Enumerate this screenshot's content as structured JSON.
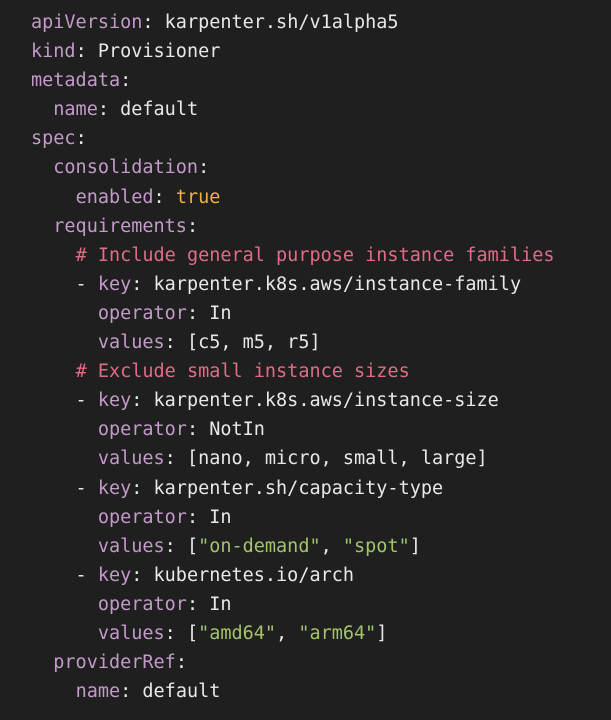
{
  "theme": {
    "background": "#1f1f1f",
    "text": "#e8e8e8",
    "key": "#c39ac9",
    "boolean": "#f2b33d",
    "string": "#a3c46b",
    "comment": "#e06c86"
  },
  "lines": [
    [
      {
        "t": "apiVersion",
        "c": "key"
      },
      {
        "t": ": ",
        "c": "punct"
      },
      {
        "t": "karpenter.sh/v1alpha5",
        "c": "plain"
      }
    ],
    [
      {
        "t": "kind",
        "c": "key"
      },
      {
        "t": ": ",
        "c": "punct"
      },
      {
        "t": "Provisioner",
        "c": "plain"
      }
    ],
    [
      {
        "t": "metadata",
        "c": "key"
      },
      {
        "t": ":",
        "c": "punct"
      }
    ],
    [
      {
        "t": "  "
      },
      {
        "t": "name",
        "c": "key"
      },
      {
        "t": ": ",
        "c": "punct"
      },
      {
        "t": "default",
        "c": "plain"
      }
    ],
    [
      {
        "t": "spec",
        "c": "key"
      },
      {
        "t": ":",
        "c": "punct"
      }
    ],
    [
      {
        "t": "  "
      },
      {
        "t": "consolidation",
        "c": "key"
      },
      {
        "t": ":",
        "c": "punct"
      }
    ],
    [
      {
        "t": "    "
      },
      {
        "t": "enabled",
        "c": "key"
      },
      {
        "t": ": ",
        "c": "punct"
      },
      {
        "t": "true",
        "c": "bool"
      }
    ],
    [
      {
        "t": "  "
      },
      {
        "t": "requirements",
        "c": "key"
      },
      {
        "t": ":",
        "c": "punct"
      }
    ],
    [
      {
        "t": "    "
      },
      {
        "t": "# Include general purpose instance families",
        "c": "comment"
      }
    ],
    [
      {
        "t": "    - ",
        "c": "punct"
      },
      {
        "t": "key",
        "c": "key"
      },
      {
        "t": ": ",
        "c": "punct"
      },
      {
        "t": "karpenter.k8s.aws/instance-family",
        "c": "plain"
      }
    ],
    [
      {
        "t": "      "
      },
      {
        "t": "operator",
        "c": "key"
      },
      {
        "t": ": ",
        "c": "punct"
      },
      {
        "t": "In",
        "c": "plain"
      }
    ],
    [
      {
        "t": "      "
      },
      {
        "t": "values",
        "c": "key"
      },
      {
        "t": ": ",
        "c": "punct"
      },
      {
        "t": "[c5, m5, r5]",
        "c": "plain"
      }
    ],
    [
      {
        "t": "    "
      },
      {
        "t": "# Exclude small instance sizes",
        "c": "comment"
      }
    ],
    [
      {
        "t": "    - ",
        "c": "punct"
      },
      {
        "t": "key",
        "c": "key"
      },
      {
        "t": ": ",
        "c": "punct"
      },
      {
        "t": "karpenter.k8s.aws/instance-size",
        "c": "plain"
      }
    ],
    [
      {
        "t": "      "
      },
      {
        "t": "operator",
        "c": "key"
      },
      {
        "t": ": ",
        "c": "punct"
      },
      {
        "t": "NotIn",
        "c": "plain"
      }
    ],
    [
      {
        "t": "      "
      },
      {
        "t": "values",
        "c": "key"
      },
      {
        "t": ": ",
        "c": "punct"
      },
      {
        "t": "[nano, micro, small, large]",
        "c": "plain"
      }
    ],
    [
      {
        "t": "    - ",
        "c": "punct"
      },
      {
        "t": "key",
        "c": "key"
      },
      {
        "t": ": ",
        "c": "punct"
      },
      {
        "t": "karpenter.sh/capacity-type",
        "c": "plain"
      }
    ],
    [
      {
        "t": "      "
      },
      {
        "t": "operator",
        "c": "key"
      },
      {
        "t": ": ",
        "c": "punct"
      },
      {
        "t": "In",
        "c": "plain"
      }
    ],
    [
      {
        "t": "      "
      },
      {
        "t": "values",
        "c": "key"
      },
      {
        "t": ": ",
        "c": "punct"
      },
      {
        "t": "[",
        "c": "punct"
      },
      {
        "t": "\"on-demand\"",
        "c": "string"
      },
      {
        "t": ", ",
        "c": "punct"
      },
      {
        "t": "\"spot\"",
        "c": "string"
      },
      {
        "t": "]",
        "c": "punct"
      }
    ],
    [
      {
        "t": "    - ",
        "c": "punct"
      },
      {
        "t": "key",
        "c": "key"
      },
      {
        "t": ": ",
        "c": "punct"
      },
      {
        "t": "kubernetes.io/arch",
        "c": "plain"
      }
    ],
    [
      {
        "t": "      "
      },
      {
        "t": "operator",
        "c": "key"
      },
      {
        "t": ": ",
        "c": "punct"
      },
      {
        "t": "In",
        "c": "plain"
      }
    ],
    [
      {
        "t": "      "
      },
      {
        "t": "values",
        "c": "key"
      },
      {
        "t": ": ",
        "c": "punct"
      },
      {
        "t": "[",
        "c": "punct"
      },
      {
        "t": "\"amd64\"",
        "c": "string"
      },
      {
        "t": ", ",
        "c": "punct"
      },
      {
        "t": "\"arm64\"",
        "c": "string"
      },
      {
        "t": "]",
        "c": "punct"
      }
    ],
    [
      {
        "t": "  "
      },
      {
        "t": "providerRef",
        "c": "key"
      },
      {
        "t": ":",
        "c": "punct"
      }
    ],
    [
      {
        "t": "    "
      },
      {
        "t": "name",
        "c": "key"
      },
      {
        "t": ": ",
        "c": "punct"
      },
      {
        "t": "default",
        "c": "plain"
      }
    ]
  ]
}
